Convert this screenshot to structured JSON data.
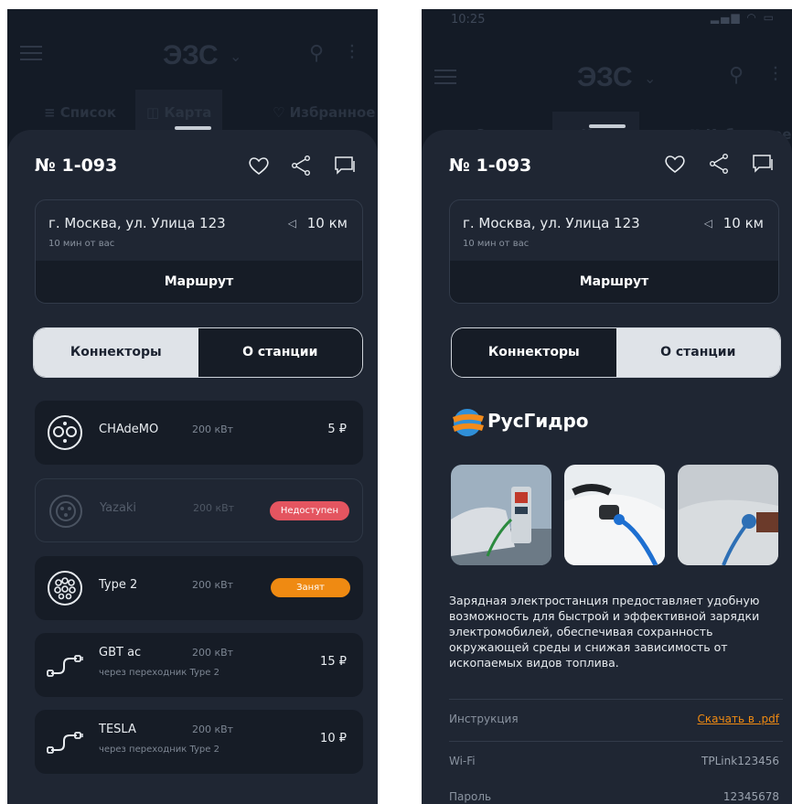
{
  "app": {
    "title": "ЭЗС",
    "status_time": "10:25",
    "tabs": [
      "Список",
      "Карта",
      "Избранное"
    ]
  },
  "station": {
    "number": "№ 1-093",
    "address": "г. Москва, ул. Улица 123",
    "eta": "10 мин от вас",
    "distance": "10 км",
    "route_label": "Маршрут"
  },
  "segment": {
    "connectors": "Коннекторы",
    "about": "О станции",
    "left_selected": "connectors",
    "right_selected": "about"
  },
  "connectors": [
    {
      "name": "CHAdeMO",
      "power": "200 кВт",
      "price": "5 ₽",
      "icon": "chademo-plug-icon"
    },
    {
      "name": "Yazaki",
      "power": "200 кВт",
      "status": "Недоступен",
      "icon": "yazaki-plug-icon"
    },
    {
      "name": "Type 2",
      "power": "200 кВт",
      "status": "Занят",
      "icon": "type2-plug-icon"
    },
    {
      "name": "GBT ac",
      "power": "200 кВт",
      "note": "через переходник Type 2",
      "price": "15 ₽",
      "icon": "adapter-cable-icon"
    },
    {
      "name": "TESLA",
      "power": "200 кВт",
      "note": "через переходник Type 2",
      "price": "10 ₽",
      "icon": "adapter-cable-icon"
    }
  ],
  "about": {
    "company": "РусГидро",
    "description": "Зарядная электростанция предоставляет удобную возможность для быстрой и эффективной зарядки электромобилей, обеспечивая сохранность окружающей среды и снижая зависимость от ископаемых видов топлива.",
    "rows": [
      {
        "label": "Инструкция",
        "value": "Скачать в .pdf"
      },
      {
        "label": "Wi-Fi",
        "value": "TPLink123456"
      },
      {
        "label": "Пароль",
        "value": "12345678"
      }
    ]
  },
  "colors": {
    "background": "#141b26",
    "sheet": "#1f2633",
    "card": "#161c26",
    "accent_orange": "#ef8a12",
    "badge_red": "#e45560"
  }
}
